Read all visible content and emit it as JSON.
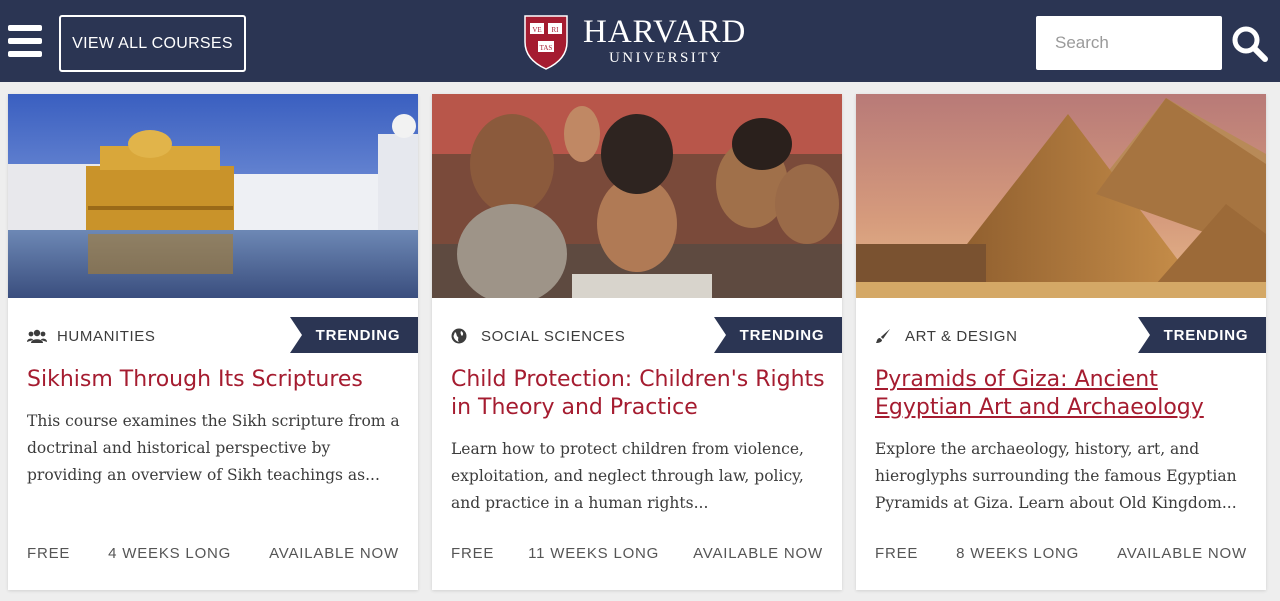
{
  "header": {
    "menu_icon": "hamburger-menu-icon",
    "view_all_label": "VIEW ALL COURSES",
    "logo": {
      "shield_text": [
        "VE",
        "RI",
        "TAS"
      ],
      "name": "HARVARD",
      "subname": "UNIVERSITY"
    },
    "search": {
      "placeholder": "Search",
      "icon": "search-icon"
    },
    "colors": {
      "background": "#2b3553",
      "text": "#ffffff"
    }
  },
  "courses": [
    {
      "category": "HUMANITIES",
      "category_icon": "users-icon",
      "badge": "TRENDING",
      "title": "Sikhism Through Its Scriptures",
      "description": "This course examines the Sikh scripture from a doctrinal and historical perspective by providing an overview of Sikh teachings as...",
      "price": "FREE",
      "duration": "4 WEEKS LONG",
      "availability": "AVAILABLE NOW"
    },
    {
      "category": "SOCIAL SCIENCES",
      "category_icon": "globe-icon",
      "badge": "TRENDING",
      "title": "Child Protection: Children's Rights in Theory and Practice",
      "description": "Learn how to protect children from violence, exploitation, and neglect through law, policy, and practice in a human rights...",
      "price": "FREE",
      "duration": "11 WEEKS LONG",
      "availability": "AVAILABLE NOW"
    },
    {
      "category": "ART & DESIGN",
      "category_icon": "paintbrush-icon",
      "badge": "TRENDING",
      "title": "Pyramids of Giza: Ancient Egyptian Art and Archaeology",
      "description": "Explore the archaeology, history, art, and hieroglyphs surrounding the famous Egyptian Pyramids at Giza. Learn about Old Kingdom...",
      "price": "FREE",
      "duration": "8 WEEKS LONG",
      "availability": "AVAILABLE NOW"
    }
  ],
  "colors": {
    "title": "#a51c30",
    "badge": "#2b3553",
    "page_background": "#eeeeee"
  }
}
